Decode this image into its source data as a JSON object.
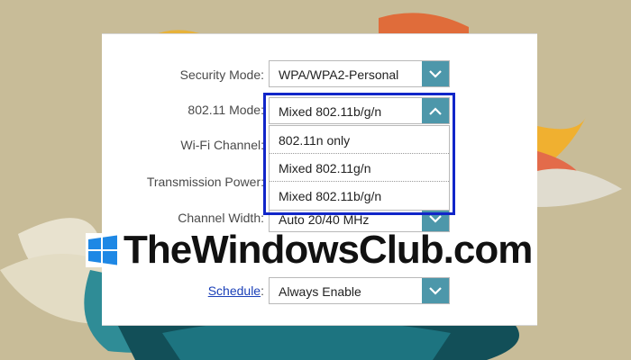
{
  "form": {
    "security_mode": {
      "label": "Security Mode",
      "value": "WPA/WPA2-Personal"
    },
    "mode_80211": {
      "label": "802.11 Mode",
      "value": "Mixed 802.11b/g/n",
      "options": [
        "802.11n only",
        "Mixed 802.11g/n",
        "Mixed 802.11b/g/n"
      ]
    },
    "wifi_channel": {
      "label": "Wi-Fi Channel"
    },
    "transmission_power": {
      "label": "Transmission Power"
    },
    "channel_width": {
      "label": "Channel Width",
      "value": "Auto 20/40 MHz"
    },
    "schedule": {
      "label": "Schedule",
      "value": "Always Enable"
    },
    "colon": ":"
  },
  "watermark": {
    "text": "TheWindowsClub.com"
  },
  "colors": {
    "accent": "#4d97aa",
    "highlight_box": "#1126c9",
    "link": "#1a3fb8"
  }
}
